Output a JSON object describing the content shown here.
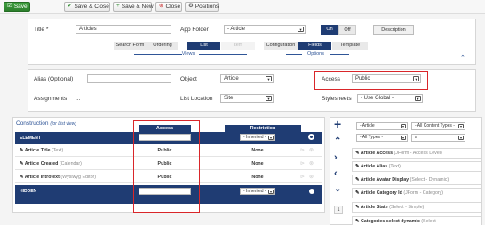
{
  "toolbar": {
    "save": "Save",
    "save_close": "Save & Close",
    "save_new": "Save & New",
    "close": "Close",
    "positions": "Positions"
  },
  "form": {
    "title_label": "Title *",
    "title_value": "Articles",
    "app_folder_label": "App Folder",
    "app_folder_value": "- Article",
    "on_label": "On",
    "off_label": "Off",
    "description_label": "Description",
    "views_tabs": [
      "Search Form",
      "Ordering",
      "List",
      "Item"
    ],
    "views_caption": "Views",
    "options_tabs": [
      "Configuration",
      "Fields",
      "Template"
    ],
    "options_caption": "Options"
  },
  "settings": {
    "alias_label": "Alias (Optional)",
    "object_label": "Object",
    "object_value": "Article",
    "access_label": "Access",
    "access_value": "Public",
    "assignments_label": "Assignments",
    "assignments_value": "...",
    "list_location_label": "List Location",
    "list_location_value": "Site",
    "stylesheets_label": "Stylesheets",
    "stylesheets_value": "- Use Global -"
  },
  "construction": {
    "title": "Construction",
    "subtitle": "(for List view)",
    "col_access": "Access",
    "col_restriction": "Restriction",
    "element_header": "ELEMENT",
    "hidden_header": "HIDDEN",
    "inherited": "- Inherited -",
    "rows": [
      {
        "name": "Article Title",
        "type": "(Text)",
        "access": "Public",
        "restriction": "None"
      },
      {
        "name": "Article Created",
        "type": "(Calendar)",
        "access": "Public",
        "restriction": "None"
      },
      {
        "name": "Article Introtext",
        "type": "(Wysiwyg Editor)",
        "access": "Public",
        "restriction": "None"
      }
    ]
  },
  "right_panel": {
    "filter1": "- Article",
    "filter2": "- All Content Types -",
    "filter3": "- All Types -",
    "filter4": "a",
    "page_number": "1",
    "fields": [
      {
        "name": "Article Access",
        "type": "(JForm - Access Level)"
      },
      {
        "name": "Article Alias",
        "type": "(Text)"
      },
      {
        "name": "Article Avatar Display",
        "type": "(Select - Dynamic)"
      },
      {
        "name": "Article Category Id",
        "type": "(JForm - Category)"
      },
      {
        "name": "Article State",
        "type": "(Select - Simple)"
      },
      {
        "name": "Categories select dynamic",
        "type": "(Select -"
      }
    ]
  }
}
